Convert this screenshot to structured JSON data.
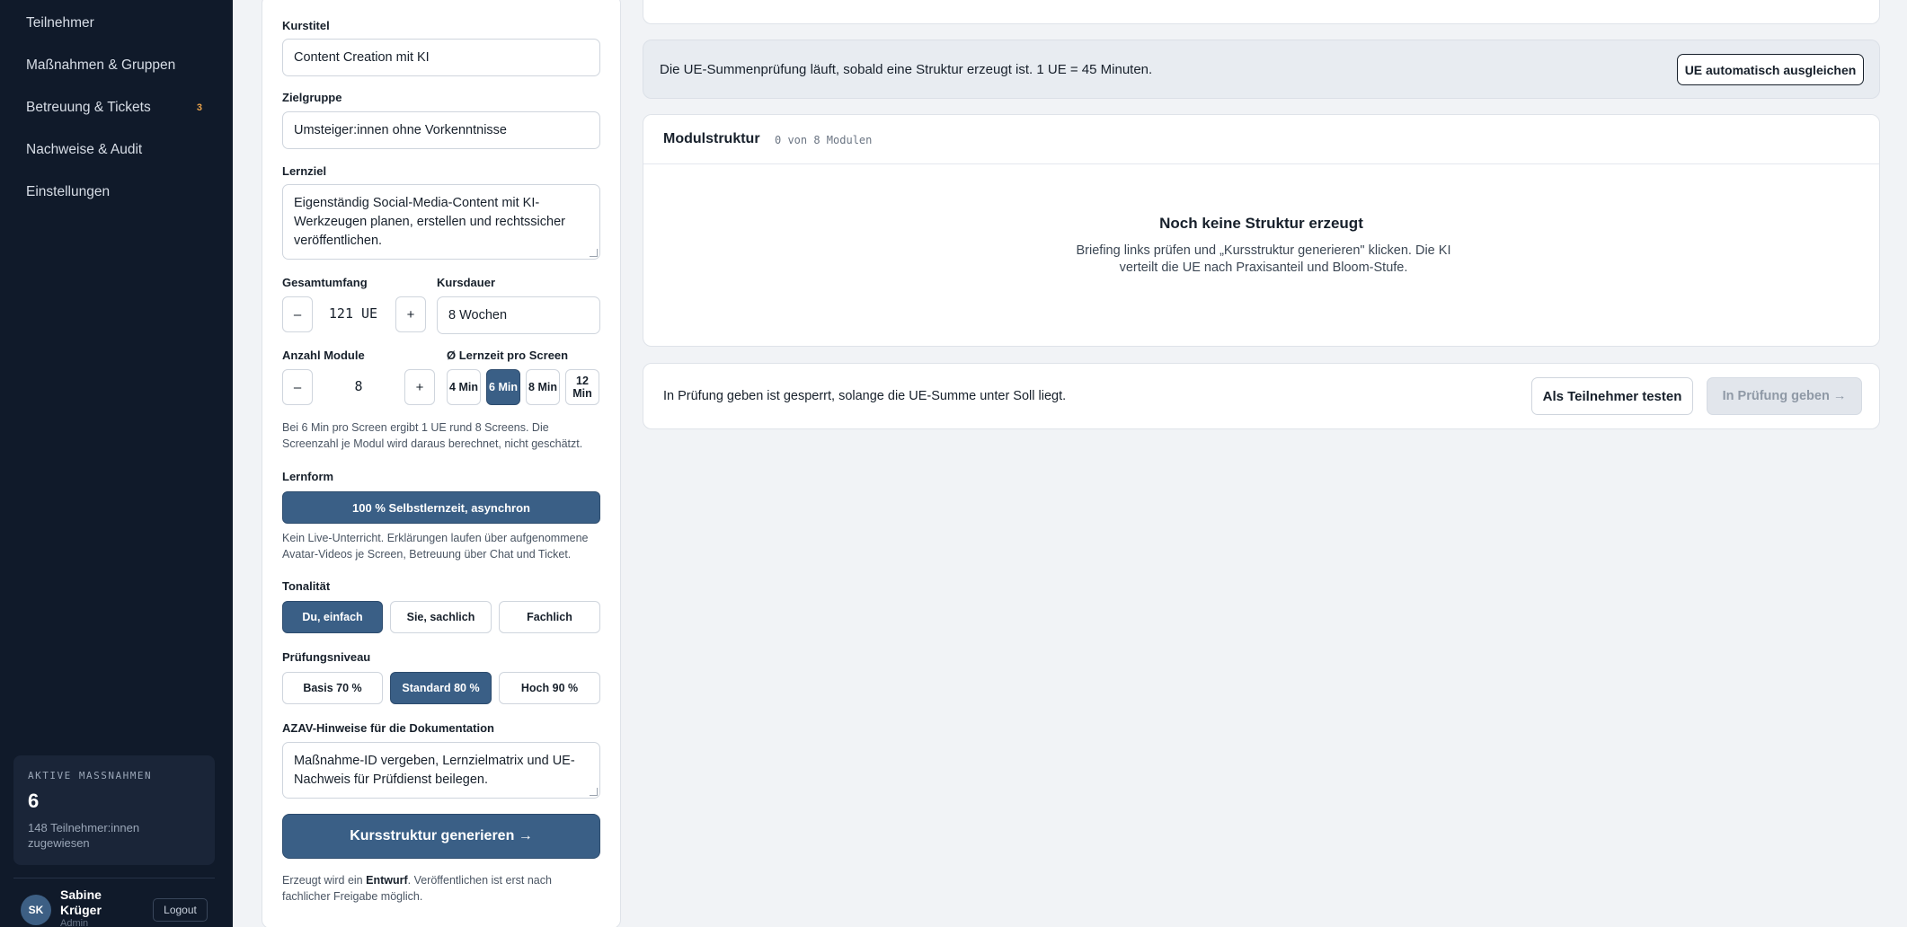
{
  "sidebar": {
    "items": [
      {
        "label": "Teilnehmer"
      },
      {
        "label": "Maßnahmen & Gruppen"
      },
      {
        "label": "Betreuung & Tickets",
        "badge": "3"
      },
      {
        "label": "Nachweise & Audit"
      },
      {
        "label": "Einstellungen"
      }
    ],
    "stat": {
      "label": "AKTIVE MASSNAHMEN",
      "value": "6",
      "sub": "148 Teilnehmer:innen zugewiesen"
    },
    "user": {
      "initials": "SK",
      "name": "Sabine Krüger",
      "role": "Admin",
      "logout": "Logout"
    }
  },
  "form": {
    "kurstitel": {
      "label": "Kurstitel",
      "value": "Content Creation mit KI"
    },
    "zielgruppe": {
      "label": "Zielgruppe",
      "value": "Umsteiger:innen ohne Vorkenntnisse"
    },
    "lernziel": {
      "label": "Lernziel",
      "value": "Eigenständig Social-Media-Content mit KI-Werkzeugen planen, erstellen und rechtssicher veröffentlichen."
    },
    "gesamtumfang": {
      "label": "Gesamtumfang",
      "value": "121 UE",
      "minus": "–",
      "plus": "+"
    },
    "kursdauer": {
      "label": "Kursdauer",
      "value": "8 Wochen"
    },
    "module": {
      "label": "Anzahl Module",
      "value": "8",
      "minus": "–",
      "plus": "+"
    },
    "lernzeit": {
      "label": "Ø Lernzeit pro Screen",
      "options": [
        "4 Min",
        "6 Min",
        "8 Min",
        "12 Min"
      ],
      "selected": "6 Min"
    },
    "lernzeit_hint": "Bei 6 Min pro Screen ergibt 1 UE rund 8 Screens. Die Screenzahl je Modul wird daraus berechnet, nicht geschätzt.",
    "lernform": {
      "label": "Lernform",
      "value": "100 % Selbstlernzeit, asynchron"
    },
    "lernform_hint": "Kein Live-Unterricht. Erklärungen laufen über aufgenommene Avatar-Videos je Screen, Betreuung über Chat und Ticket.",
    "tonalitaet": {
      "label": "Tonalität",
      "options": [
        "Du, einfach",
        "Sie, sachlich",
        "Fachlich"
      ],
      "selected": "Du, einfach"
    },
    "pruefungsniveau": {
      "label": "Prüfungsniveau",
      "options": [
        "Basis 70 %",
        "Standard 80 %",
        "Hoch 90 %"
      ],
      "selected": "Standard 80 %"
    },
    "azav": {
      "label": "AZAV-Hinweise für die Dokumentation",
      "value": "Maßnahme-ID vergeben, Lernzielmatrix und UE-Nachweis für Prüfdienst beilegen."
    },
    "generate": "Kursstruktur generieren →",
    "footer_pre": "Erzeugt wird ein ",
    "footer_bold": "Entwurf",
    "footer_post": ". Veröffentlichen ist erst nach fachlicher Freigabe möglich."
  },
  "main": {
    "info_text": "Die UE-Summenprüfung läuft, sobald eine Struktur erzeugt ist. 1 UE = 45 Minuten.",
    "auto_balance": "UE automatisch ausgleichen",
    "module_title": "Modulstruktur",
    "module_count": "0 von 8 Modulen",
    "empty_title": "Noch keine Struktur erzeugt",
    "empty_desc": "Briefing links prüfen und „Kursstruktur generieren\" klicken. Die KI verteilt die UE nach Praxisanteil und Bloom-Stufe.",
    "review_text": "In Prüfung geben ist gesperrt, solange die UE-Summe unter Soll liegt.",
    "test_button": "Als Teilnehmer testen",
    "review_button": "In Prüfung geben →"
  }
}
